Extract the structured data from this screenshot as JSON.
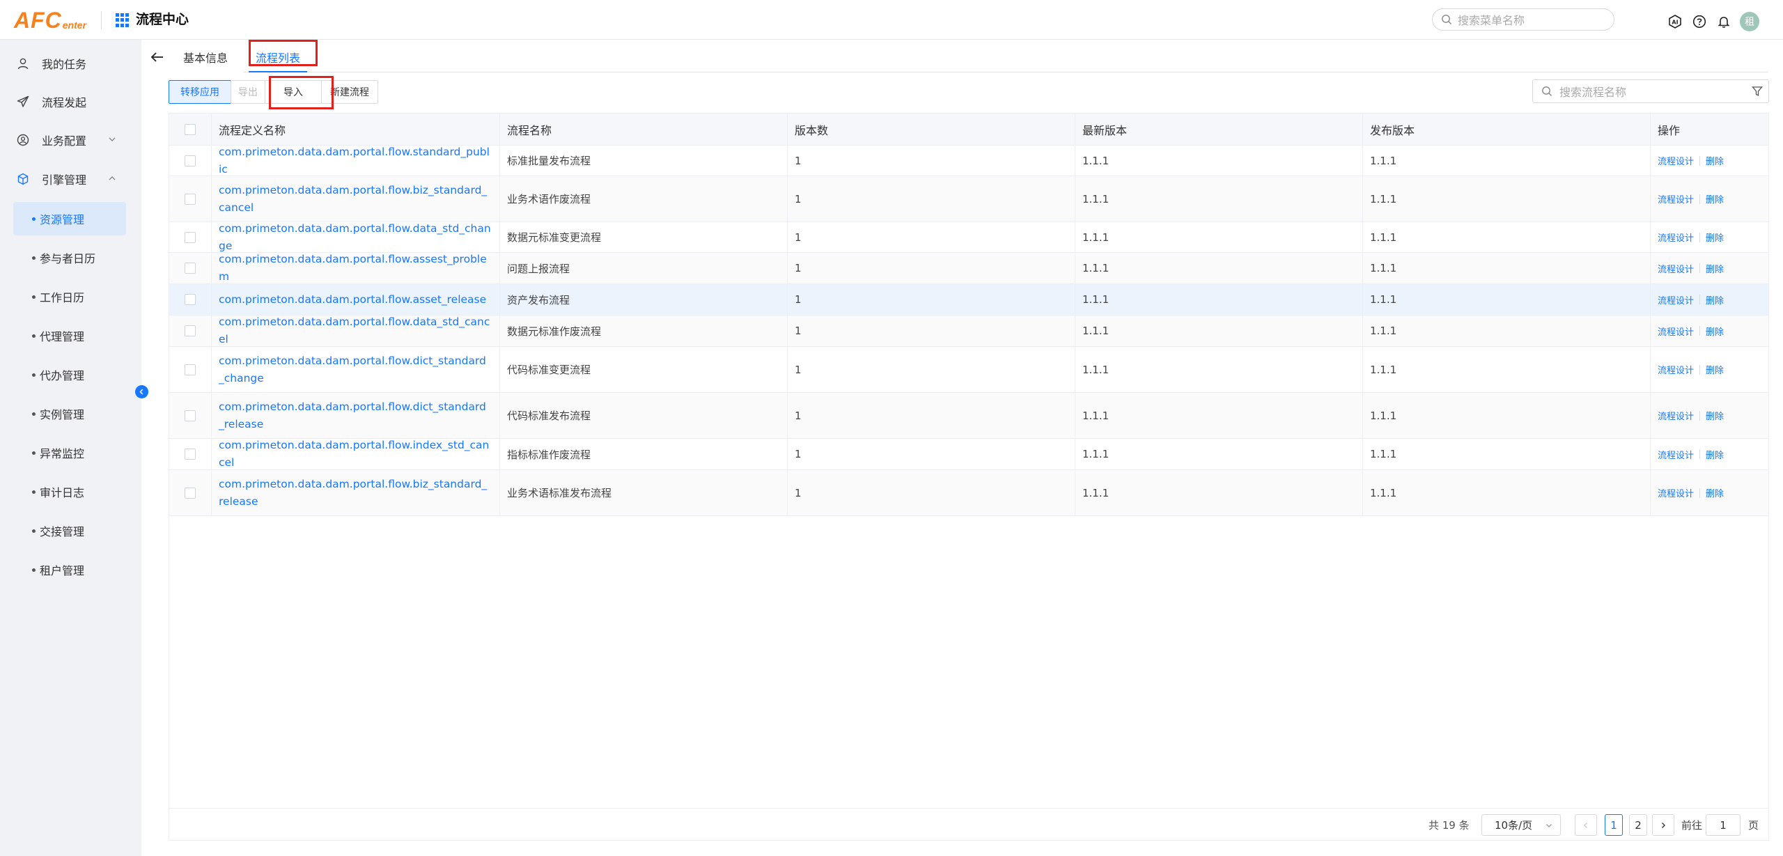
{
  "header": {
    "logo_big": "AFC",
    "logo_small": "enter",
    "app_title": "流程中心",
    "search_placeholder": "搜索菜单名称",
    "avatar_text": "租"
  },
  "sidebar": {
    "items": [
      {
        "label": "我的任务",
        "icon": "user-icon"
      },
      {
        "label": "流程发起",
        "icon": "send-icon"
      },
      {
        "label": "业务配置",
        "icon": "user-circle-icon"
      },
      {
        "label": "引擎管理",
        "icon": "cube-icon"
      }
    ],
    "sub_items": [
      {
        "label": "资源管理",
        "active": true
      },
      {
        "label": "参与者日历"
      },
      {
        "label": "工作日历"
      },
      {
        "label": "代理管理"
      },
      {
        "label": "代办管理"
      },
      {
        "label": "实例管理"
      },
      {
        "label": "异常监控"
      },
      {
        "label": "审计日志"
      },
      {
        "label": "交接管理"
      },
      {
        "label": "租户管理"
      }
    ]
  },
  "tabs": [
    {
      "label": "基本信息"
    },
    {
      "label": "流程列表",
      "active": true
    }
  ],
  "toolbar": {
    "transfer": "转移应用",
    "export": "导出",
    "import": "导入",
    "new_flow": "新建流程",
    "search_placeholder": "搜索流程名称"
  },
  "table": {
    "headers": [
      "流程定义名称",
      "流程名称",
      "版本数",
      "最新版本",
      "发布版本",
      "操作"
    ],
    "rows": [
      {
        "def": "com.primeton.data.dam.portal.flow.standard_public",
        "name": "标准批量发布流程",
        "count": "1",
        "latest": "1.1.1",
        "published": "1.1.1"
      },
      {
        "def": "com.primeton.data.dam.portal.flow.biz_standard_cancel",
        "name": "业务术语作废流程",
        "count": "1",
        "latest": "1.1.1",
        "published": "1.1.1"
      },
      {
        "def": "com.primeton.data.dam.portal.flow.data_std_change",
        "name": "数据元标准变更流程",
        "count": "1",
        "latest": "1.1.1",
        "published": "1.1.1"
      },
      {
        "def": "com.primeton.data.dam.portal.flow.assest_problem",
        "name": "问题上报流程",
        "count": "1",
        "latest": "1.1.1",
        "published": "1.1.1"
      },
      {
        "def": "com.primeton.data.dam.portal.flow.asset_release",
        "name": "资产发布流程",
        "count": "1",
        "latest": "1.1.1",
        "published": "1.1.1"
      },
      {
        "def": "com.primeton.data.dam.portal.flow.data_std_cancel",
        "name": "数据元标准作废流程",
        "count": "1",
        "latest": "1.1.1",
        "published": "1.1.1"
      },
      {
        "def": "com.primeton.data.dam.portal.flow.dict_standard_change",
        "name": "代码标准变更流程",
        "count": "1",
        "latest": "1.1.1",
        "published": "1.1.1"
      },
      {
        "def": "com.primeton.data.dam.portal.flow.dict_standard_release",
        "name": "代码标准发布流程",
        "count": "1",
        "latest": "1.1.1",
        "published": "1.1.1"
      },
      {
        "def": "com.primeton.data.dam.portal.flow.index_std_cancel",
        "name": "指标标准作废流程",
        "count": "1",
        "latest": "1.1.1",
        "published": "1.1.1"
      },
      {
        "def": "com.primeton.data.dam.portal.flow.biz_standard_release",
        "name": "业务术语标准发布流程",
        "count": "1",
        "latest": "1.1.1",
        "published": "1.1.1"
      }
    ],
    "op_design": "流程设计",
    "op_delete": "删除"
  },
  "pagination": {
    "total": "共 19 条",
    "page_size": "10条/页",
    "pages": [
      "1",
      "2"
    ],
    "current": "1",
    "goto_label": "前往",
    "goto_value": "1",
    "page_suffix": "页"
  },
  "colors": {
    "accent": "#1677ff",
    "highlight": "#e0201b",
    "logo": "#f5821f"
  }
}
